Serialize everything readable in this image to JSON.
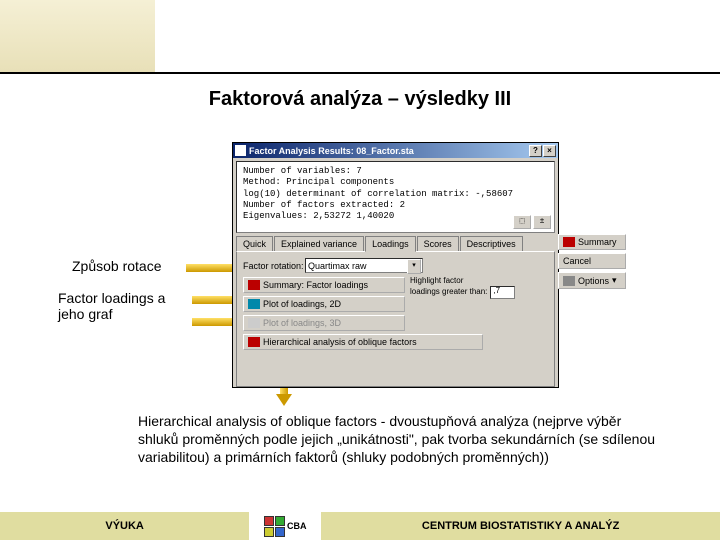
{
  "title": "Faktorová analýza – výsledky III",
  "dialog": {
    "titlebar": "Factor Analysis Results: 08_Factor.sta",
    "info": {
      "l1": "Number of variables: 7",
      "l2": "Method: Principal components",
      "l3": "log(10) determinant of correlation matrix: -,58607",
      "l4": "Number of factors extracted: 2",
      "l5": "Eigenvalues: 2,53272  1,40020"
    },
    "tabs": [
      "Quick",
      "Explained variance",
      "Loadings",
      "Scores",
      "Descriptives"
    ],
    "active_tab": 2,
    "factor_rotation_label": "Factor rotation:",
    "factor_rotation_value": "Quartimax raw",
    "buttons": {
      "summary": "Summary: Factor loadings",
      "plot2d": "Plot of loadings, 2D",
      "plot3d": "Plot of loadings, 3D",
      "hier": "Hierarchical analysis of oblique factors"
    },
    "highlight": {
      "label1": "Highlight factor",
      "label2": "loadings greater than:",
      "value": ",7"
    },
    "side": {
      "summary": "Summary",
      "cancel": "Cancel",
      "options": "Options"
    },
    "titlebar_help": "?",
    "titlebar_close": "×"
  },
  "annotations": {
    "rotace": "Způsob rotace",
    "loadings": "Factor loadings a jeho graf"
  },
  "body_text": "Hierarchical analysis of oblique factors - dvoustupňová analýza (nejprve výběr shluků proměnných podle jejich „unikátnosti\", pak tvorba sekundárních (se sdílenou variabilitou) a primárních faktorů (shluky podobných proměnných))",
  "footer": {
    "left": "VÝUKA",
    "right": "CENTRUM BIOSTATISTIKY A ANALÝZ",
    "logo": "CBA"
  }
}
